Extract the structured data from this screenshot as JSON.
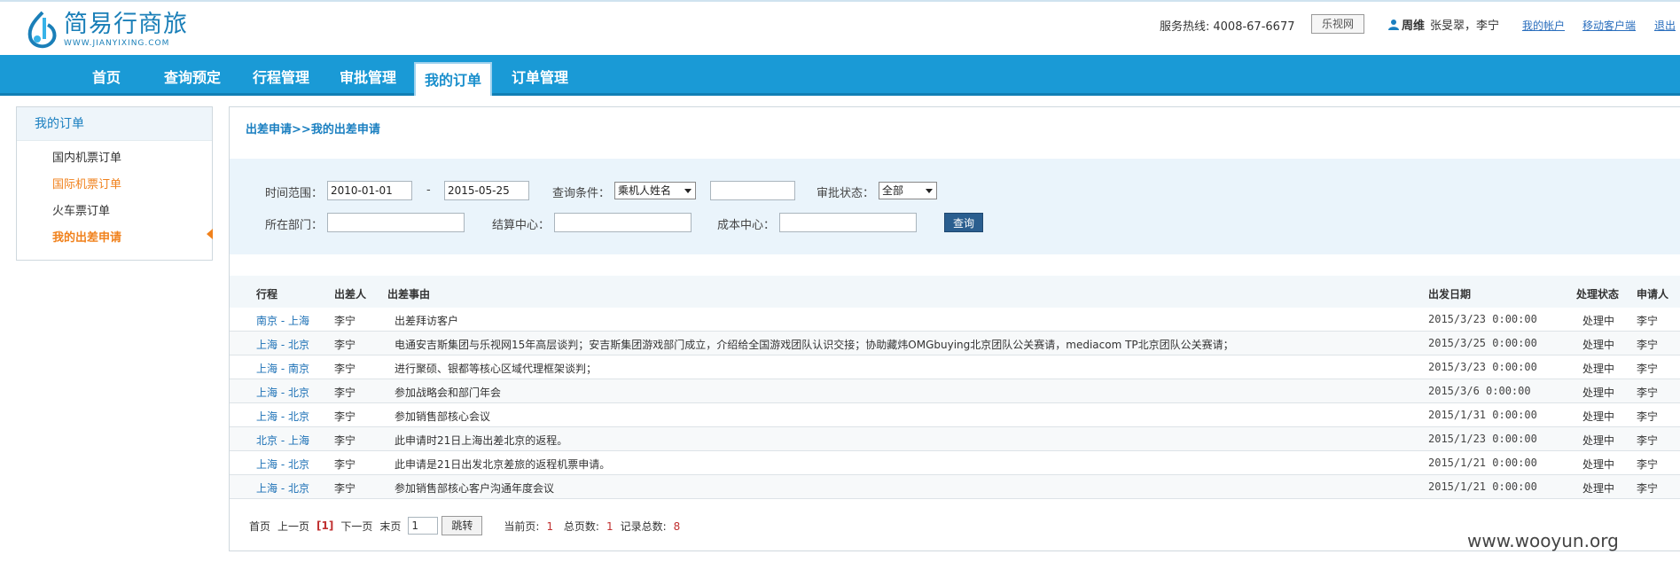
{
  "header": {
    "logo_cn": "简易行商旅",
    "logo_en": "WWW.JIANYIXING.COM",
    "hotline_label": "服务热线:",
    "hotline_number": "4008-67-6677",
    "partner_button": "乐视网",
    "user_name": "周维",
    "user_extra": "张旻翠，李宁",
    "link_account": "我的帐户",
    "link_mobile": "移动客户端",
    "link_logout": "退出"
  },
  "nav": {
    "items": [
      {
        "label": "首页"
      },
      {
        "label": "查询预定"
      },
      {
        "label": "行程管理"
      },
      {
        "label": "审批管理"
      },
      {
        "label": "我的订单"
      },
      {
        "label": "订单管理"
      }
    ]
  },
  "sidebar": {
    "title": "我的订单",
    "items": [
      {
        "label": "国内机票订单"
      },
      {
        "label": "国际机票订单"
      },
      {
        "label": "火车票订单"
      },
      {
        "label": "我的出差申请"
      }
    ]
  },
  "breadcrumb": {
    "parent": "出差申请",
    "sep": ">>",
    "current": "我的出差申请"
  },
  "filters": {
    "time_range_label": "时间范围：",
    "date_from": "2010-01-01",
    "dash": "-",
    "date_to": "2015-05-25",
    "query_cond_label": "查询条件：",
    "query_cond_value": "乘机人姓名",
    "query_keyword": "",
    "approval_label": "审批状态：",
    "approval_value": "全部",
    "dept_label": "所在部门：",
    "dept_value": "",
    "settle_label": "结算中心：",
    "settle_value": "",
    "cost_label": "成本中心：",
    "cost_value": "",
    "query_button": "查询"
  },
  "table": {
    "headers": {
      "route": "行程",
      "traveler": "出差人",
      "reason": "出差事由",
      "date": "出发日期",
      "status": "处理状态",
      "applicant": "申请人"
    },
    "rows": [
      {
        "route": "南京 - 上海",
        "traveler": "李宁",
        "reason": "出差拜访客户",
        "date": "2015/3/23 0:00:00",
        "status": "处理中",
        "applicant": "李宁"
      },
      {
        "route": "上海 - 北京",
        "traveler": "李宁",
        "reason": "电通安吉斯集团与乐视网15年高层谈判；安吉斯集团游戏部门成立，介绍给全国游戏团队认识交接；协助藏炜OMGbuying北京团队公关赛请，mediacom TP北京团队公关赛请；",
        "date": "2015/3/25 0:00:00",
        "status": "处理中",
        "applicant": "李宁"
      },
      {
        "route": "上海 - 南京",
        "traveler": "李宁",
        "reason": "进行聚硕、银都等核心区域代理框架谈判；",
        "date": "2015/3/23 0:00:00",
        "status": "处理中",
        "applicant": "李宁"
      },
      {
        "route": "上海 - 北京",
        "traveler": "李宁",
        "reason": "参加战略会和部门年会",
        "date": "2015/3/6 0:00:00",
        "status": "处理中",
        "applicant": "李宁"
      },
      {
        "route": "上海 - 北京",
        "traveler": "李宁",
        "reason": "参加销售部核心会议",
        "date": "2015/1/31 0:00:00",
        "status": "处理中",
        "applicant": "李宁"
      },
      {
        "route": "北京 - 上海",
        "traveler": "李宁",
        "reason": "此申请时21日上海出差北京的返程。",
        "date": "2015/1/23 0:00:00",
        "status": "处理中",
        "applicant": "李宁"
      },
      {
        "route": "上海 - 北京",
        "traveler": "李宁",
        "reason": "此申请是21日出发北京差旅的返程机票申请。",
        "date": "2015/1/21 0:00:00",
        "status": "处理中",
        "applicant": "李宁"
      },
      {
        "route": "上海 - 北京",
        "traveler": "李宁",
        "reason": "参加销售部核心客户沟通年度会议",
        "date": "2015/1/21 0:00:00",
        "status": "处理中",
        "applicant": "李宁"
      }
    ]
  },
  "pager": {
    "first": "首页",
    "prev": "上一页",
    "current": "[1]",
    "next": "下一页",
    "last": "末页",
    "page_input": "1",
    "jump_button": "跳转",
    "current_page_label": "当前页:",
    "current_page": "1",
    "total_pages_label": "总页数:",
    "total_pages": "1",
    "total_records_label": "记录总数:",
    "total_records": "8"
  },
  "watermark": "www.wooyun.org",
  "colors": {
    "nav_blue": "#1a9ad6",
    "link_blue": "#1a7fc0",
    "orange": "#f0811c",
    "button_dark_blue": "#2a5e8f"
  }
}
